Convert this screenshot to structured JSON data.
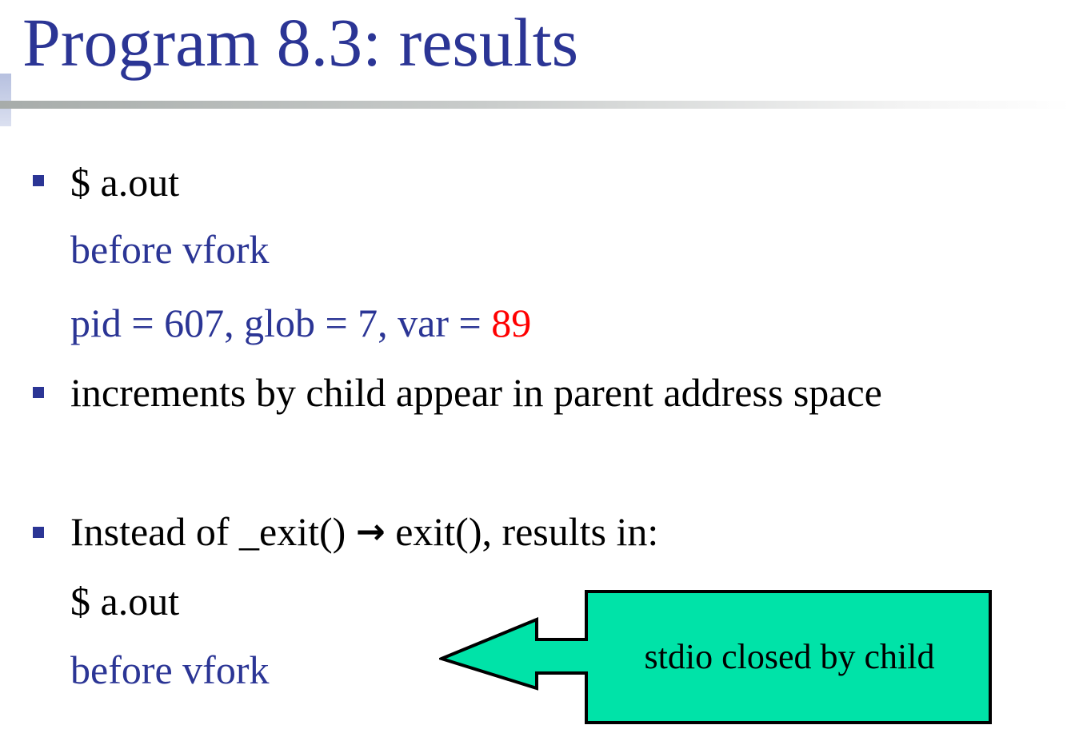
{
  "slide": {
    "title": "Program 8.3: results"
  },
  "bullets": [
    {
      "command": "$ a.out",
      "output_line1": "before vfork",
      "output_line2_prefix": "pid = 607, glob = 7, var = ",
      "output_line2_highlight": "89"
    },
    {
      "text": "increments by child appear in parent address space"
    },
    {
      "text_before_arrow": "Instead of _exit() ",
      "arrow": "→",
      "text_after_arrow": " exit(), results in:",
      "command": "$ a.out",
      "output_line1": "before vfork"
    }
  ],
  "callout": {
    "text": "stdio closed by child"
  },
  "colors": {
    "title": "#2b3595",
    "output_text": "#2b3595",
    "highlight": "#ff0000",
    "bullet": "#2b3595",
    "callout_fill": "#00e3a8"
  }
}
